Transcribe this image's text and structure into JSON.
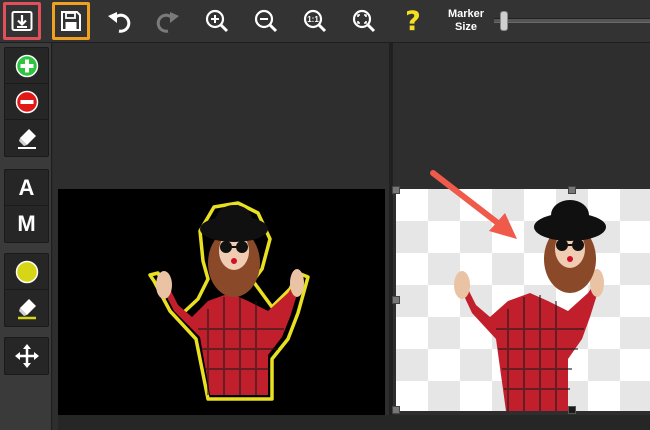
{
  "toolbar": {
    "download_icon": "download-icon",
    "save_icon": "save-icon",
    "undo_icon": "undo-icon",
    "redo_icon": "redo-icon",
    "zoom_in_icon": "zoom-in-icon",
    "zoom_out_icon": "zoom-out-icon",
    "zoom_actual_icon": "zoom-actual-size-icon",
    "zoom_actual_text": "1:1",
    "zoom_fit_icon": "zoom-fit-icon",
    "help_label": "?",
    "marker_size_label": "Marker\nSize",
    "marker_size_level": 0.04,
    "highlight_colors": {
      "download": "#e0505a",
      "save": "#f0a020"
    }
  },
  "tools": {
    "keep": {
      "icon": "plus-circle-icon",
      "color": "#2ec440"
    },
    "remove": {
      "icon": "minus-circle-icon",
      "color": "#e01818"
    },
    "eraser": {
      "icon": "eraser-icon"
    },
    "auto_label": "A",
    "manual_label": "M",
    "color_picker": {
      "icon": "color-dot-icon",
      "color": "#d6d616"
    },
    "color_eraser": {
      "icon": "eraser-highlight-icon",
      "color": "#d6d616"
    },
    "move": {
      "icon": "move-arrows-icon"
    }
  },
  "canvas": {
    "left_outline_color": "#e8e020",
    "right_background": "transparent-checkerboard",
    "arrow_color": "#f05a4a"
  }
}
